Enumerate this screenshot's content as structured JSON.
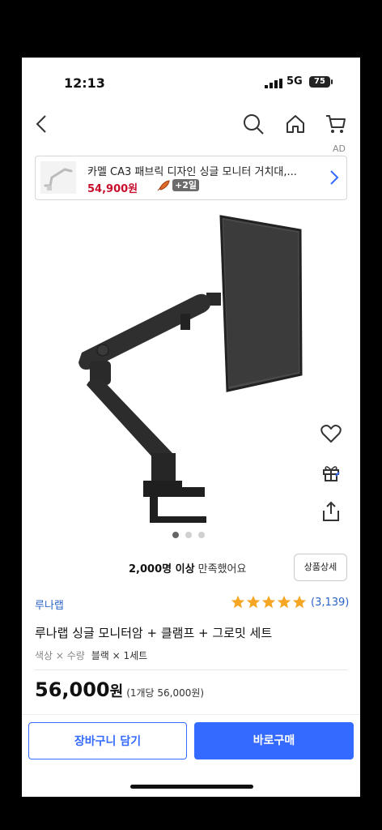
{
  "status_bar": {
    "time": "12:13",
    "network": "5G",
    "battery": "75"
  },
  "nav": {
    "back": "back-arrow",
    "icons": [
      "search-icon",
      "home-icon",
      "cart-icon"
    ]
  },
  "ad": {
    "tag": "AD",
    "title": "카멜 CA3 패브릭 디자인 싱글 모니터 거치대,...",
    "price": "54,900원",
    "delivery_badge": "+2일"
  },
  "gallery": {
    "total_images": 3,
    "active_index": 0
  },
  "satisfaction": {
    "count": "2,000명 이상",
    "text": "만족했어요"
  },
  "detail_button": "상품상세",
  "product": {
    "brand": "루나랩",
    "rating": 5,
    "review_count": "(3,139)",
    "title": "루나랩 싱글 모니터암 + 클램프 + 그로밋 세트",
    "option_label": "색상 × 수량",
    "option_value": "블랙 × 1세트",
    "price": "56,000",
    "price_unit": "원",
    "unit_price": "(1개당 56,000원)"
  },
  "actions": {
    "cart": "장바구니 담기",
    "buy": "바로구매"
  },
  "colors": {
    "accent": "#346aff",
    "price_red": "#c8102e",
    "brand_blue": "#2c63c8",
    "star": "#f5a623"
  }
}
